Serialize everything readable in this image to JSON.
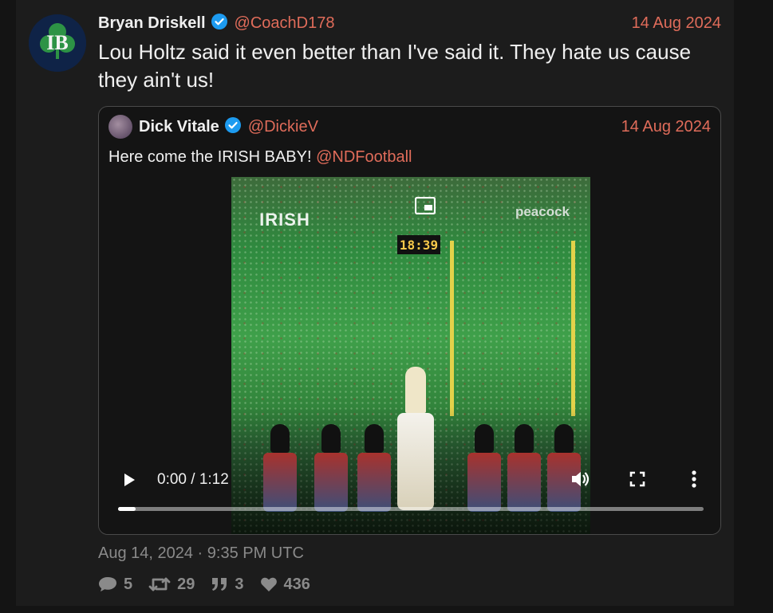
{
  "tweet": {
    "avatar_text": "IB",
    "fullname": "Bryan Driskell",
    "username": "@CoachD178",
    "date": "14 Aug 2024",
    "text": "Lou Holtz said it even better than I've said it. They hate us cause they ain't us!",
    "timestamp": "Aug 14, 2024 · 9:35 PM UTC",
    "stats": {
      "replies": "5",
      "retweets": "29",
      "quotes": "3",
      "likes": "436"
    }
  },
  "quote": {
    "fullname": "Dick Vitale",
    "username": "@DickieV",
    "date": "14 Aug 2024",
    "text": "Here come the IRISH BABY! ",
    "mention": "@NDFootball",
    "video": {
      "time": "0:00 / 1:12",
      "progress": 0.03,
      "overlay_logo": "IRISH",
      "overlay_brand": "peacock",
      "scoreboard": "18:39"
    }
  },
  "colors": {
    "accent": "#e06c5a",
    "verified": "#1d9bf0",
    "background": "#1c1c1c"
  },
  "icons": {
    "verified": "verified-badge-icon",
    "reply": "comment-icon",
    "retweet": "retweet-icon",
    "quote": "quote-icon",
    "like": "heart-icon",
    "play": "play-icon",
    "volume": "volume-icon",
    "fullscreen": "fullscreen-icon",
    "more": "more-vertical-icon",
    "pip": "picture-in-picture-icon"
  }
}
